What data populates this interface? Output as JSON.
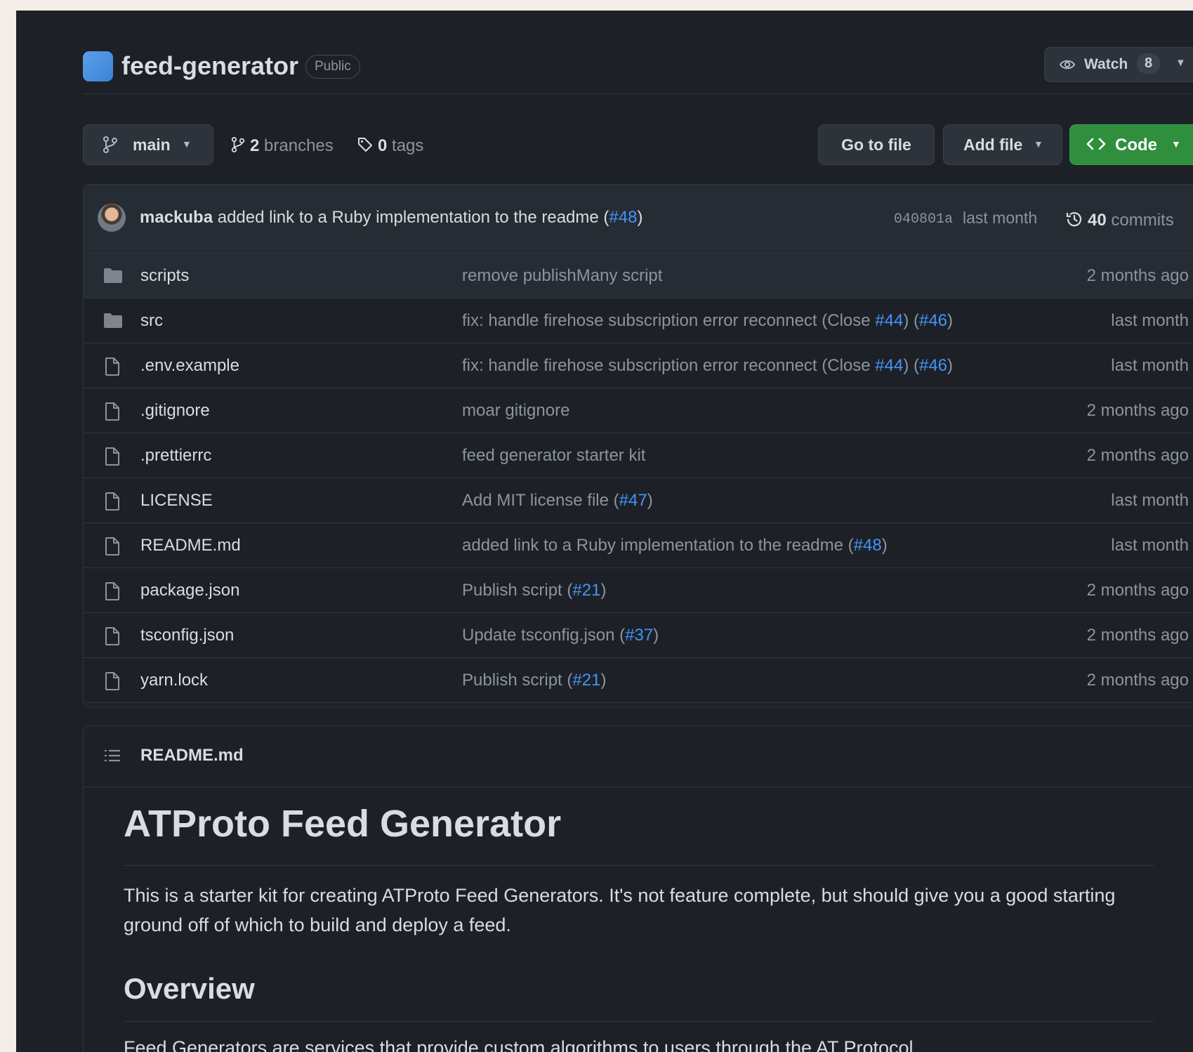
{
  "repo": {
    "name": "feed-generator",
    "visibility": "Public",
    "watch_label": "Watch",
    "watch_count": "8"
  },
  "toolbar": {
    "branch": "main",
    "branches_count": "2",
    "branches_label": "branches",
    "tags_count": "0",
    "tags_label": "tags",
    "goto_file": "Go to file",
    "add_file": "Add file",
    "code": "Code"
  },
  "commit": {
    "author": "mackuba",
    "message": "added link to a Ruby implementation to the readme",
    "open_paren": "(",
    "pr": "#48",
    "close_paren": ")",
    "sha": "040801a",
    "time": "last month",
    "count": "40",
    "count_label": "commits"
  },
  "files": [
    {
      "name": "scripts",
      "type": "folder",
      "msg": "remove publishMany script",
      "refs": [],
      "age": "2 months ago"
    },
    {
      "name": "src",
      "type": "folder",
      "msg": "fix: handle firehose subscription error reconnect (Close ",
      "refs": [
        "#44",
        ") (",
        "#46",
        ")"
      ],
      "age": "last month"
    },
    {
      "name": ".env.example",
      "type": "file",
      "msg": "fix: handle firehose subscription error reconnect (Close ",
      "refs": [
        "#44",
        ") (",
        "#46",
        ")"
      ],
      "age": "last month"
    },
    {
      "name": ".gitignore",
      "type": "file",
      "msg": "moar gitignore",
      "refs": [],
      "age": "2 months ago"
    },
    {
      "name": ".prettierrc",
      "type": "file",
      "msg": "feed generator starter kit",
      "refs": [],
      "age": "2 months ago"
    },
    {
      "name": "LICENSE",
      "type": "file",
      "msg": "Add MIT license file (",
      "refs": [
        "#47",
        ")"
      ],
      "age": "last month"
    },
    {
      "name": "README.md",
      "type": "file",
      "msg": "added link to a Ruby implementation to the readme (",
      "refs": [
        "#48",
        ")"
      ],
      "age": "last month"
    },
    {
      "name": "package.json",
      "type": "file",
      "msg": "Publish script (",
      "refs": [
        "#21",
        ")"
      ],
      "age": "2 months ago"
    },
    {
      "name": "tsconfig.json",
      "type": "file",
      "msg": "Update tsconfig.json (",
      "refs": [
        "#37",
        ")"
      ],
      "age": "2 months ago"
    },
    {
      "name": "yarn.lock",
      "type": "file",
      "msg": "Publish script (",
      "refs": [
        "#21",
        ")"
      ],
      "age": "2 months ago"
    }
  ],
  "readme": {
    "filename": "README.md",
    "h1": "ATProto Feed Generator",
    "p1": "This is a starter kit for creating ATProto Feed Generators. It's not feature complete, but should give you a good starting ground off of which to build and deploy a feed.",
    "h2": "Overview",
    "p2": "Feed Generators are services that provide custom algorithms to users through the AT Protocol."
  },
  "colors": {
    "background": "#1d2127",
    "accent_green": "#2f8f3c",
    "link": "#4493f8"
  }
}
